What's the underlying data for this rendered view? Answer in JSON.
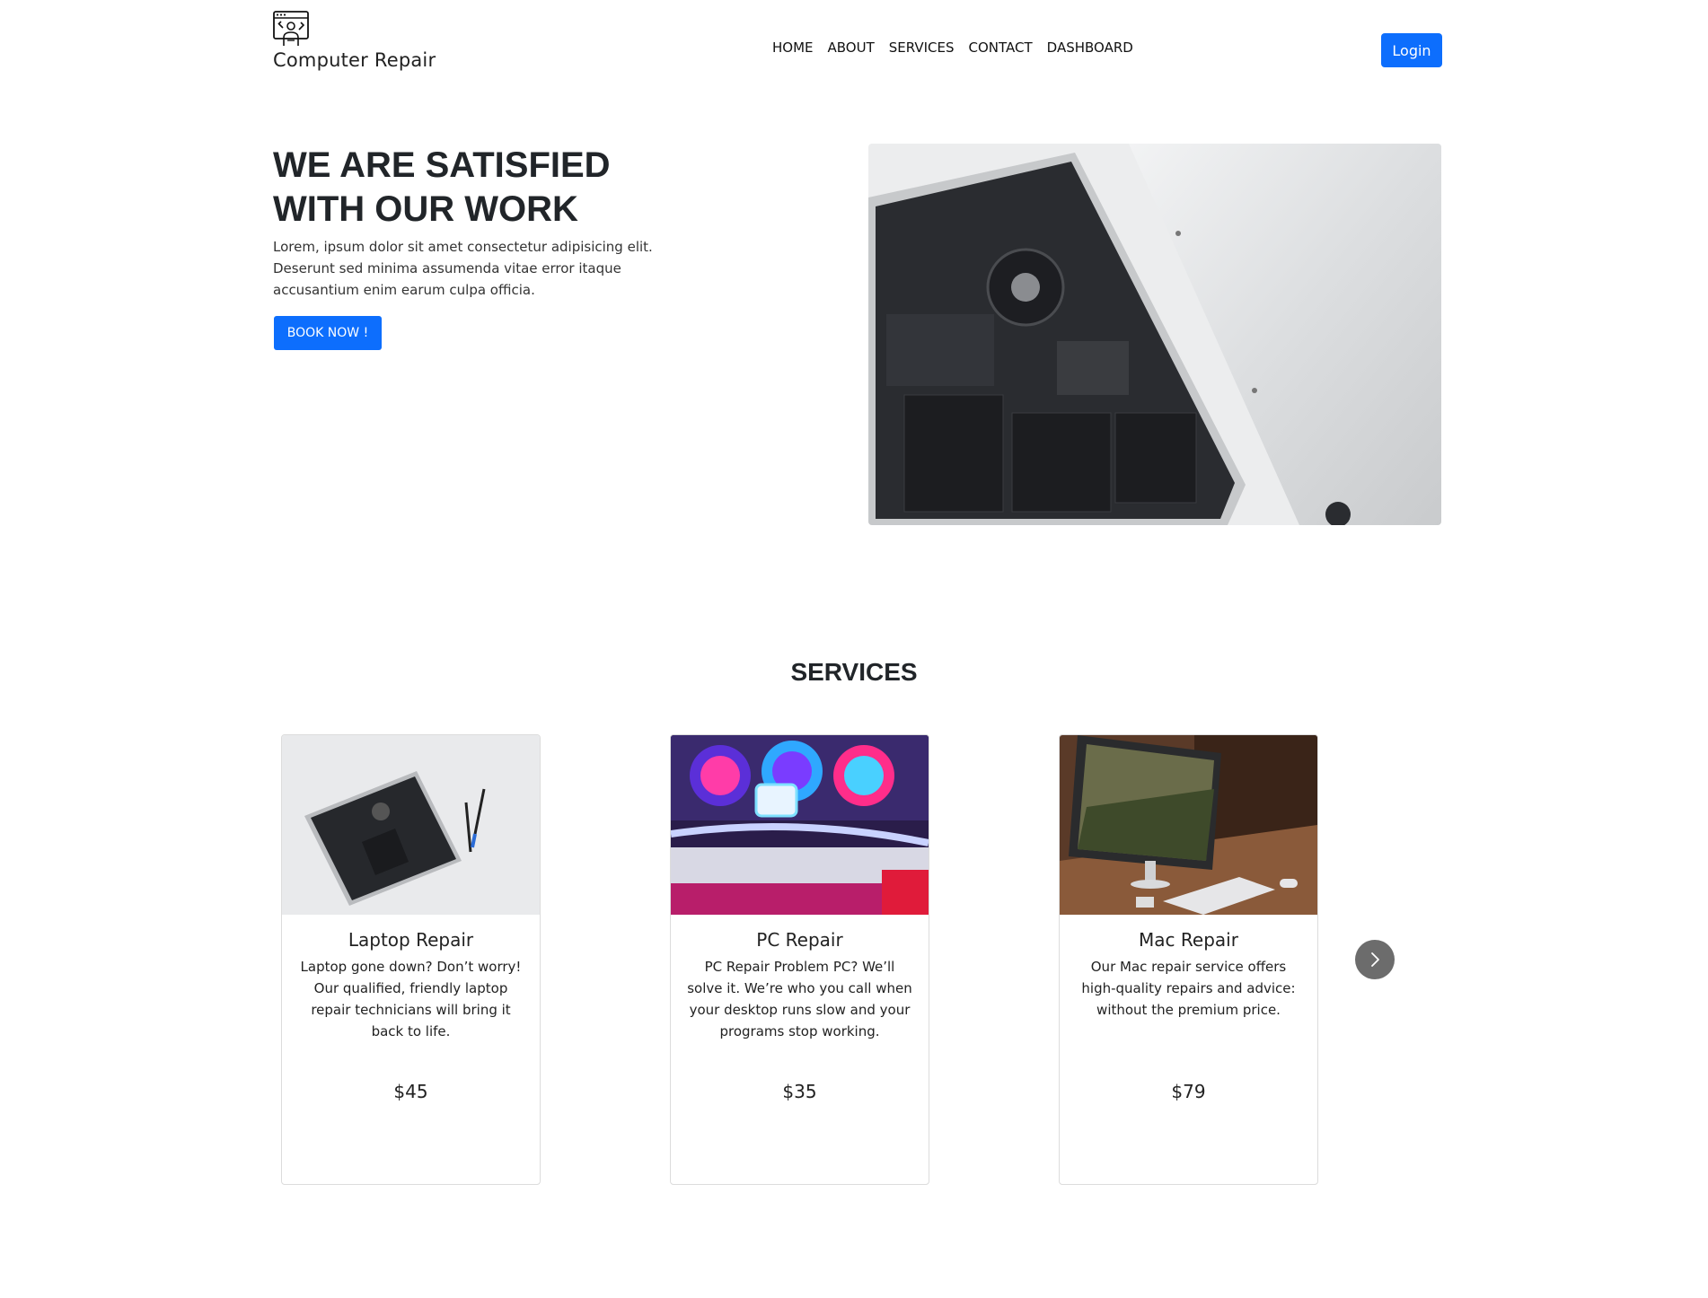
{
  "header": {
    "brand_icon": "technician-computer-icon",
    "brand_name": "Computer Repair",
    "nav": [
      "HOME",
      "ABOUT",
      "SERVICES",
      "CONTACT",
      "DASHBOARD"
    ],
    "login_label": "Login"
  },
  "hero": {
    "title_line1": "WE ARE SATISFIED",
    "title_line2": "WITH OUR WORK",
    "text": "Lorem, ipsum dolor sit amet consectetur adipisicing elit. Deserunt sed minima assumenda vitae error itaque accusantium enim earum culpa officia.",
    "book_label": "BOOK NOW !",
    "image": "open-laptop-internals-photo"
  },
  "services": {
    "title": "SERVICES",
    "cards": [
      {
        "image": "laptop-repair-photo",
        "title": "Laptop Repair",
        "text": "Laptop gone down? Don’t worry! Our qualified, friendly laptop repair technicians will bring it back to life.",
        "price": "$45"
      },
      {
        "image": "rgb-pc-internals-photo",
        "title": "PC Repair",
        "text": "PC Repair Problem PC? We’ll solve it. We’re who you call when your desktop runs slow and your programs stop working.",
        "price": "$35"
      },
      {
        "image": "imac-desk-photo",
        "title": "Mac Repair",
        "text": "Our Mac repair service offers high-quality repairs and advice: without the premium price.",
        "price": "$79"
      }
    ],
    "next_icon": "chevron-right-icon"
  },
  "colors": {
    "primary": "#0d6efd",
    "carousel_button": "#6c6c6c"
  }
}
